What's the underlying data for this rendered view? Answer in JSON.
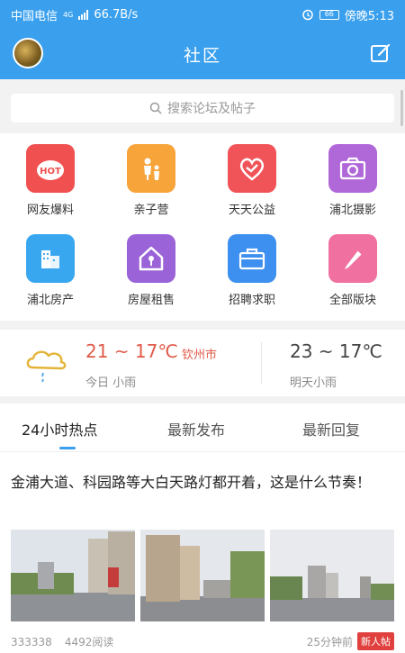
{
  "statusbar": {
    "carrier": "中国电信",
    "net": "4G",
    "speed": "66.7B/s",
    "battery": "66",
    "time": "傍晚5:13"
  },
  "header": {
    "title": "社区"
  },
  "search": {
    "placeholder": "搜索论坛及帖子"
  },
  "grid": {
    "items": [
      {
        "label": "网友爆料",
        "color": "#f05050",
        "icon": "hot-icon"
      },
      {
        "label": "亲子营",
        "color": "#f7a43a",
        "icon": "family-icon"
      },
      {
        "label": "天天公益",
        "color": "#f05358",
        "icon": "heart-icon"
      },
      {
        "label": "浦北摄影",
        "color": "#b068d9",
        "icon": "camera-icon"
      },
      {
        "label": "浦北房产",
        "color": "#39a7ef",
        "icon": "building-icon"
      },
      {
        "label": "房屋租售",
        "color": "#9a63d8",
        "icon": "house-icon"
      },
      {
        "label": "招聘求职",
        "color": "#3d8ff0",
        "icon": "briefcase-icon"
      },
      {
        "label": "全部版块",
        "color": "#f070a0",
        "icon": "pencil-icon"
      }
    ]
  },
  "weather": {
    "today_temp": "21 ~ 17℃",
    "city": "钦州市",
    "today_desc": "今日 小雨",
    "tomorrow_temp": "23 ~ 17℃",
    "tomorrow_desc": "明天小雨",
    "icon": "cloud-rain-icon"
  },
  "tabs": [
    {
      "label": "24小时热点",
      "active": true
    },
    {
      "label": "最新发布",
      "active": false
    },
    {
      "label": "最新回复",
      "active": false
    }
  ],
  "post": {
    "title": "金浦大道、科园路等大白天路灯都开着，这是什么节奏！",
    "views": "333338",
    "reads": "4492阅读",
    "time": "25分钟前",
    "badge": "新人帖"
  }
}
